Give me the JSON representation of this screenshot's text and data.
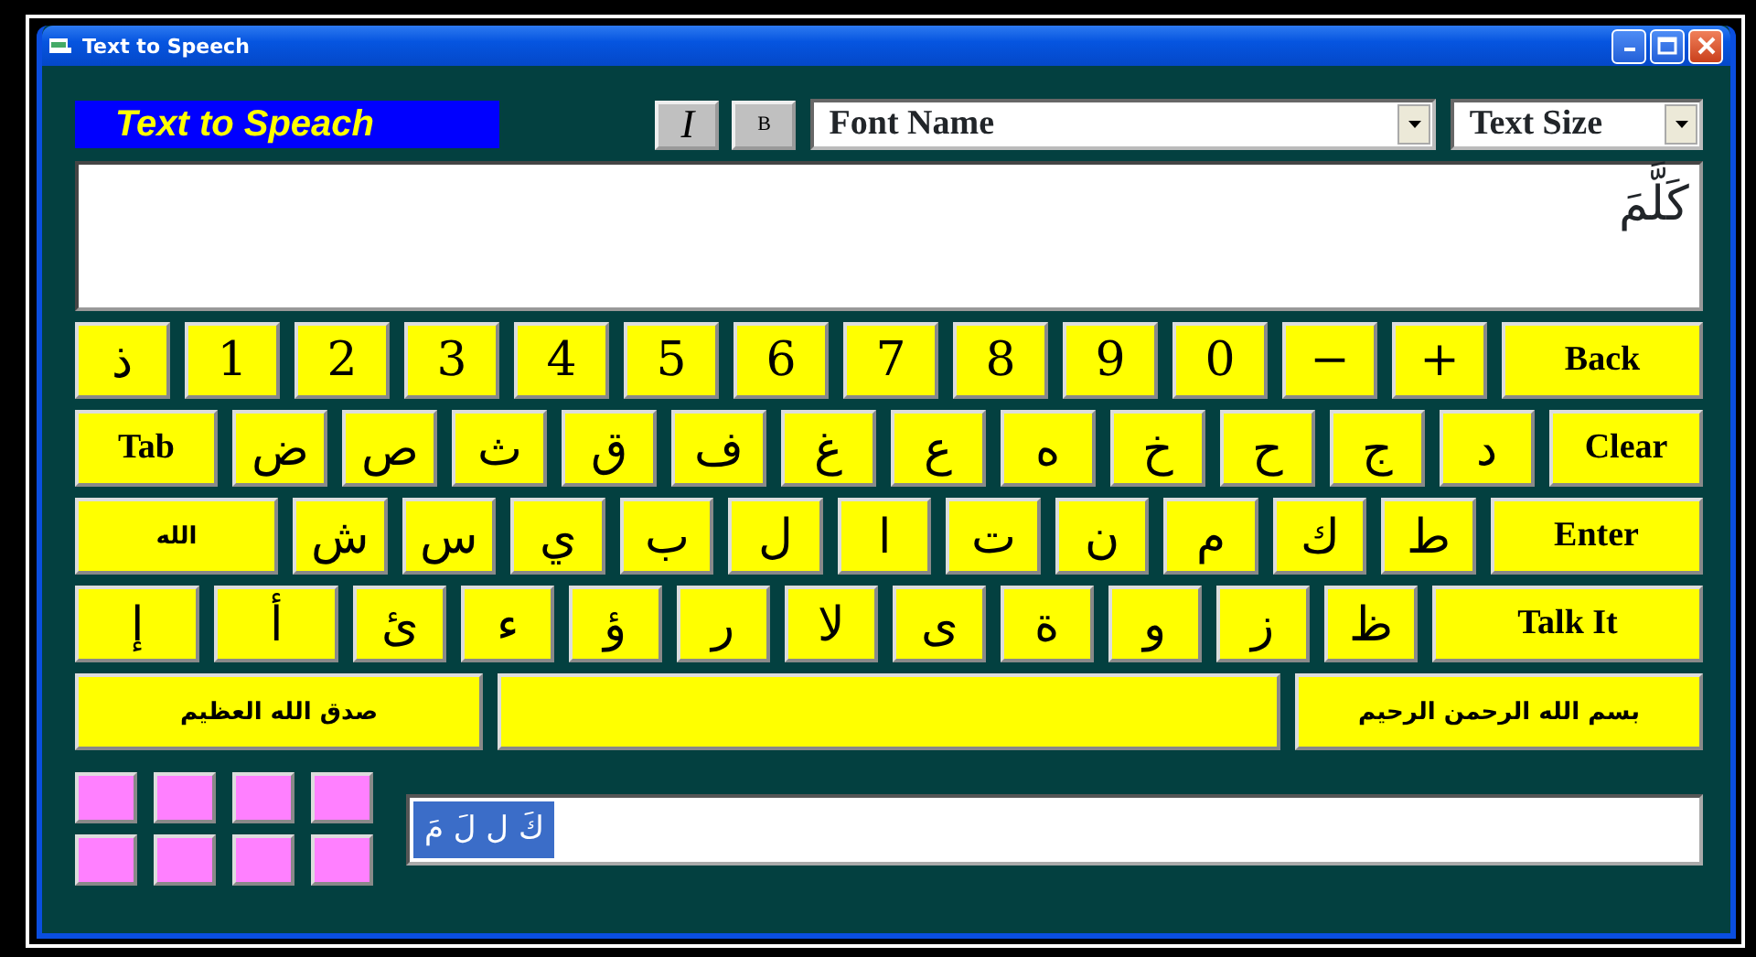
{
  "window": {
    "title": "Text to Speech"
  },
  "toolbar": {
    "banner": "Text to Speach",
    "italic_button": "I",
    "bold_button": "B",
    "font_select": "Font Name",
    "size_select": "Text Size"
  },
  "editor": {
    "value": "كَلَّمَ"
  },
  "keyboard": [
    [
      {
        "label": "Back",
        "kind": "command"
      },
      {
        "label": "+",
        "kind": "char"
      },
      {
        "label": "−",
        "kind": "char"
      },
      {
        "label": "0",
        "kind": "char"
      },
      {
        "label": "9",
        "kind": "char"
      },
      {
        "label": "8",
        "kind": "char"
      },
      {
        "label": "7",
        "kind": "char"
      },
      {
        "label": "6",
        "kind": "char"
      },
      {
        "label": "5",
        "kind": "char"
      },
      {
        "label": "4",
        "kind": "char"
      },
      {
        "label": "3",
        "kind": "char"
      },
      {
        "label": "2",
        "kind": "char"
      },
      {
        "label": "1",
        "kind": "char"
      },
      {
        "label": "ذ",
        "kind": "char"
      }
    ],
    [
      {
        "label": "Clear",
        "kind": "command"
      },
      {
        "label": "د",
        "kind": "char"
      },
      {
        "label": "ج",
        "kind": "char"
      },
      {
        "label": "ح",
        "kind": "char"
      },
      {
        "label": "خ",
        "kind": "char"
      },
      {
        "label": "ه",
        "kind": "char"
      },
      {
        "label": "ع",
        "kind": "char"
      },
      {
        "label": "غ",
        "kind": "char"
      },
      {
        "label": "ف",
        "kind": "char"
      },
      {
        "label": "ق",
        "kind": "char"
      },
      {
        "label": "ث",
        "kind": "char"
      },
      {
        "label": "ص",
        "kind": "char"
      },
      {
        "label": "ض",
        "kind": "char"
      },
      {
        "label": "Tab",
        "kind": "command"
      }
    ],
    [
      {
        "label": "Enter",
        "kind": "command"
      },
      {
        "label": "ط",
        "kind": "char"
      },
      {
        "label": "ك",
        "kind": "char"
      },
      {
        "label": "م",
        "kind": "char"
      },
      {
        "label": "ن",
        "kind": "char"
      },
      {
        "label": "ت",
        "kind": "char"
      },
      {
        "label": "ا",
        "kind": "char"
      },
      {
        "label": "ل",
        "kind": "char"
      },
      {
        "label": "ب",
        "kind": "char"
      },
      {
        "label": "ي",
        "kind": "char"
      },
      {
        "label": "س",
        "kind": "char"
      },
      {
        "label": "ش",
        "kind": "char"
      },
      {
        "label": "الله",
        "kind": "phrase"
      }
    ],
    [
      {
        "label": "Talk It",
        "kind": "command"
      },
      {
        "label": "ظ",
        "kind": "char"
      },
      {
        "label": "ز",
        "kind": "char"
      },
      {
        "label": "و",
        "kind": "char"
      },
      {
        "label": "ة",
        "kind": "char"
      },
      {
        "label": "ى",
        "kind": "char"
      },
      {
        "label": "لا",
        "kind": "char"
      },
      {
        "label": "ر",
        "kind": "char"
      },
      {
        "label": "ؤ",
        "kind": "char"
      },
      {
        "label": "ء",
        "kind": "char"
      },
      {
        "label": "ئ",
        "kind": "char"
      },
      {
        "label": "أ",
        "kind": "char"
      },
      {
        "label": "إ",
        "kind": "char"
      }
    ],
    [
      {
        "label": "بسم الله الرحمن الرحيم",
        "kind": "phrase"
      },
      {
        "kind": "space"
      },
      {
        "label": "صدق الله العظيم",
        "kind": "phrase"
      }
    ]
  ],
  "swatches": [
    {
      "color": "#ff80ff"
    },
    {
      "color": "#ff80ff"
    },
    {
      "color": "#ff80ff"
    },
    {
      "color": "#ff80ff"
    },
    {
      "color": "#ff80ff"
    },
    {
      "color": "#ff80ff"
    },
    {
      "color": "#ff80ff"
    },
    {
      "color": "#ff80ff"
    }
  ],
  "letters_field": {
    "value": "كَ ل لَ مَ",
    "highlighted": true
  }
}
